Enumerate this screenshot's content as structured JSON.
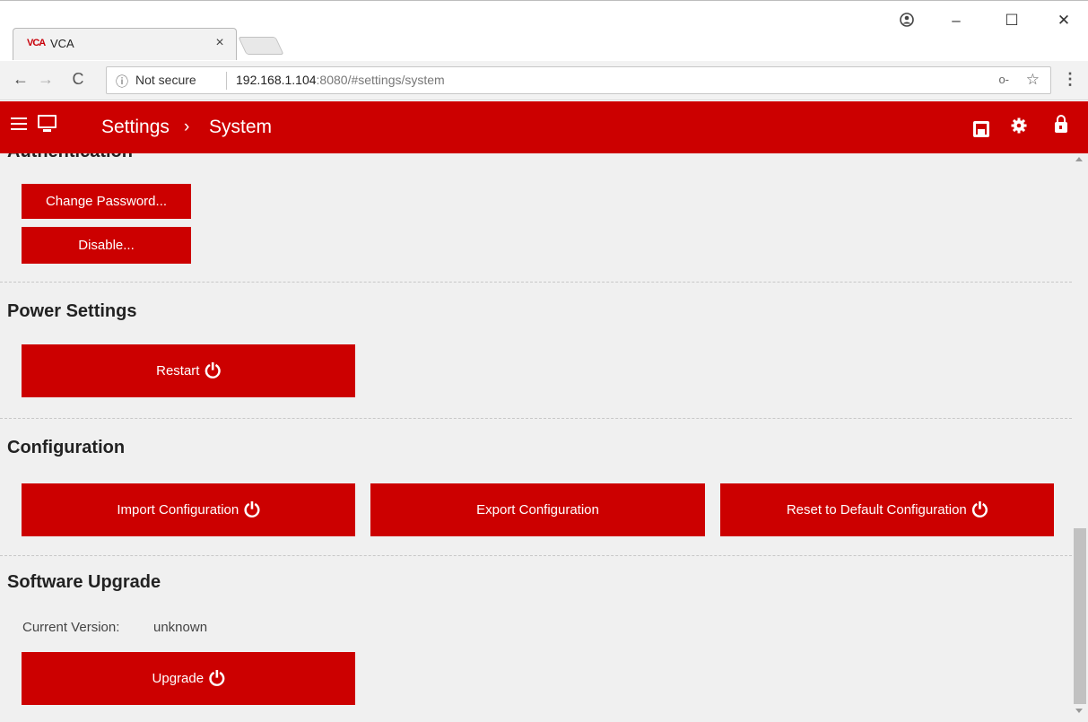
{
  "browser": {
    "tab_title": "VCA",
    "tab_favicon": "VCA",
    "tab_close": "×",
    "security_text": "Not secure",
    "url_host": "192.168.1.104",
    "url_rest": ":8080/#settings/system",
    "icons": {
      "back": "←",
      "forward": "→",
      "reload": "C",
      "info": "ⓘ",
      "key": "o‑",
      "star": "☆",
      "menu": "⋮",
      "user": "👤",
      "minimize": "–",
      "maximize": "☐",
      "close": "✕"
    }
  },
  "header": {
    "title": "Settings",
    "separator": "›",
    "subtitle": "System",
    "accent_color": "#cc0000"
  },
  "sections": {
    "authentication": {
      "title": "Authentication",
      "change_password_label": "Change Password...",
      "disable_label": "Disable..."
    },
    "power": {
      "title": "Power Settings",
      "restart_label": "Restart"
    },
    "configuration": {
      "title": "Configuration",
      "import_label": "Import Configuration",
      "export_label": "Export Configuration",
      "reset_label": "Reset to Default Configuration"
    },
    "upgrade": {
      "title": "Software Upgrade",
      "version_label": "Current Version:",
      "version_value": "unknown",
      "upgrade_label": "Upgrade"
    }
  },
  "power_glyph": "⏻"
}
